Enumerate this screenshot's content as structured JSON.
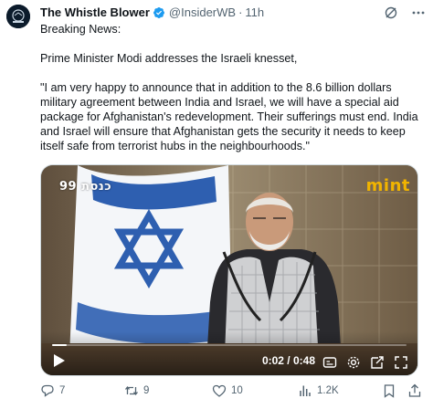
{
  "tweet": {
    "author": {
      "display_name": "The Whistle Blower",
      "handle": "@InsiderWB",
      "separator": "·",
      "time": "11h",
      "avatar_icon": "whistleblower-avatar",
      "verified_icon": "verified-badge-icon"
    },
    "header_actions": [
      "grok-icon",
      "more-icon"
    ],
    "body": {
      "breaking": "Breaking News:",
      "headline": "Prime Minister Modi addresses the Israeli knesset,",
      "quote": "\"I am very happy to announce that in addition to the 8.6 billion dollars military agreement between India and Israel, we will have a special aid package for Afghanistan's redevelopment. Their sufferings must end. India and Israel will ensure that Afghanistan gets the security it needs to keep itself safe from terrorist hubs in the neighbourhoods.\""
    },
    "video": {
      "watermark_left": "כנסת 99",
      "watermark_right": "mint",
      "current_time": "0:02",
      "duration": "0:48",
      "time_display": "0:02 / 0:48",
      "progress": 0.042,
      "icons": [
        "play-icon",
        "captions-icon",
        "settings-icon",
        "pop-out-icon",
        "fullscreen-icon"
      ]
    },
    "actions": {
      "replies": "7",
      "retweets": "9",
      "likes": "10",
      "views": "1.2K"
    },
    "colors": {
      "text": "#0f1419",
      "secondary_text": "#536471",
      "verified": "#1d9bf0",
      "watermark_mint": "#f1b400"
    }
  }
}
